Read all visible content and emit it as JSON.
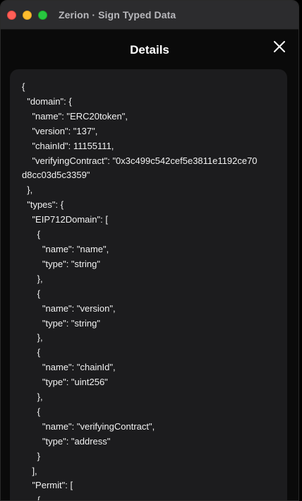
{
  "window": {
    "title": "Zerion · Sign Typed Data"
  },
  "header": {
    "title": "Details"
  },
  "details": {
    "json_text": "{\n  \"domain\": {\n    \"name\": \"ERC20token\",\n    \"version\": \"137\",\n    \"chainId\": 11155111,\n    \"verifyingContract\": \"0x3c499c542cef5e3811e1192ce70\nd8cc03d5c3359\"\n  },\n  \"types\": {\n    \"EIP712Domain\": [\n      {\n        \"name\": \"name\",\n        \"type\": \"string\"\n      },\n      {\n        \"name\": \"version\",\n        \"type\": \"string\"\n      },\n      {\n        \"name\": \"chainId\",\n        \"type\": \"uint256\"\n      },\n      {\n        \"name\": \"verifyingContract\",\n        \"type\": \"address\"\n      }\n    ],\n    \"Permit\": [\n      {\n        \"name\": \"owner\","
  },
  "icons": {
    "close": "close-icon"
  },
  "colors": {
    "window_bg": "#0a0a0a",
    "titlebar_bg": "#2c2c2e",
    "panel_bg": "#1c1c1e",
    "text": "#f2f2f2",
    "close_red": "#ff5f57",
    "minimize_yellow": "#febc2e",
    "zoom_green": "#28c840"
  }
}
